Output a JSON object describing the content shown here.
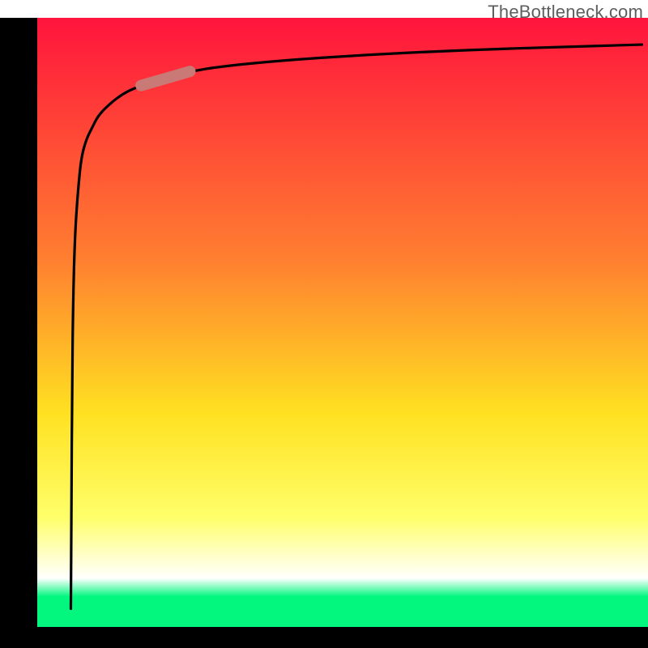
{
  "watermark": "TheBottleneck.com",
  "chart_data": {
    "type": "line",
    "title": "",
    "subtitle": "",
    "xlabel": "",
    "ylabel": "",
    "xlim": [
      0,
      100
    ],
    "ylim": [
      0,
      100
    ],
    "annotations": [
      {
        "name": "highlight-segment",
        "x": 21,
        "y": 88
      }
    ],
    "gradient_bg": {
      "direction": "vertical",
      "stops": [
        {
          "pos": 0.0,
          "color": "#ff143c"
        },
        {
          "pos": 0.4,
          "color": "#ff8030"
        },
        {
          "pos": 0.65,
          "color": "#ffe121"
        },
        {
          "pos": 0.82,
          "color": "#ffff6a"
        },
        {
          "pos": 0.92,
          "color": "#ffffff"
        },
        {
          "pos": 0.95,
          "color": "#03f77f"
        },
        {
          "pos": 1.0,
          "color": "#03f77f"
        }
      ]
    },
    "series": [
      {
        "name": "bottleneck-curve",
        "x": [
          5.5,
          5.6,
          5.7,
          5.9,
          6.2,
          6.7,
          7.2,
          8,
          9,
          10,
          12,
          14,
          16,
          20,
          25,
          30,
          40,
          55,
          70,
          85,
          99
        ],
        "values": [
          3,
          20,
          40,
          55,
          65,
          72,
          77,
          80,
          82,
          84,
          86,
          87.5,
          88.5,
          90,
          91.2,
          92,
          93,
          94,
          94.7,
          95.2,
          95.6
        ]
      }
    ],
    "colors": {
      "axis_black": "#000000",
      "curve": "#000000",
      "highlight": "#c97a76"
    }
  }
}
